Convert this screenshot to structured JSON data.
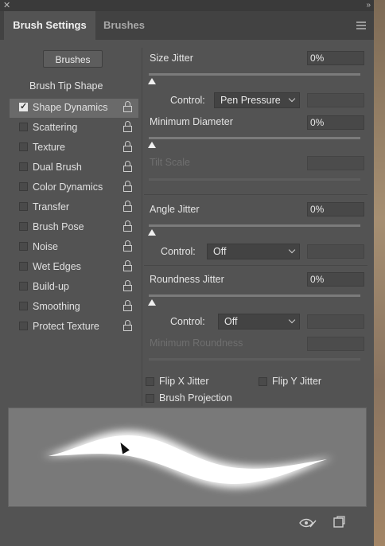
{
  "tabs": {
    "active": "Brush Settings",
    "inactive": "Brushes"
  },
  "sidebar": {
    "brushes_button": "Brushes",
    "tip_shape": "Brush Tip Shape",
    "items": [
      {
        "label": "Shape Dynamics",
        "checked": true,
        "selected": true
      },
      {
        "label": "Scattering",
        "checked": false
      },
      {
        "label": "Texture",
        "checked": false
      },
      {
        "label": "Dual Brush",
        "checked": false
      },
      {
        "label": "Color Dynamics",
        "checked": false
      },
      {
        "label": "Transfer",
        "checked": false
      },
      {
        "label": "Brush Pose",
        "checked": false
      },
      {
        "label": "Noise",
        "checked": false
      },
      {
        "label": "Wet Edges",
        "checked": false
      },
      {
        "label": "Build-up",
        "checked": false
      },
      {
        "label": "Smoothing",
        "checked": false
      },
      {
        "label": "Protect Texture",
        "checked": false
      }
    ]
  },
  "settings": {
    "size_jitter": {
      "label": "Size Jitter",
      "value": "0%"
    },
    "control_1": {
      "label": "Control:",
      "value": "Pen Pressure"
    },
    "min_diameter": {
      "label": "Minimum Diameter",
      "value": "0%"
    },
    "tilt_scale": {
      "label": "Tilt Scale"
    },
    "angle_jitter": {
      "label": "Angle Jitter",
      "value": "0%"
    },
    "control_2": {
      "label": "Control:",
      "value": "Off"
    },
    "roundness_jitter": {
      "label": "Roundness Jitter",
      "value": "0%"
    },
    "control_3": {
      "label": "Control:",
      "value": "Off"
    },
    "min_roundness": {
      "label": "Minimum Roundness"
    },
    "flip_x": "Flip X Jitter",
    "flip_y": "Flip Y Jitter",
    "brush_projection": "Brush Projection"
  },
  "icons": {
    "close": "close-icon",
    "collapse": "collapse-icon",
    "menu": "panel-menu-icon",
    "lock": "lock-icon",
    "eye": "toggle-preview-icon",
    "new": "new-preset-icon"
  },
  "colors": {
    "panel": "#535353",
    "tabbar": "#424242",
    "highlight": "#6a6a6a"
  }
}
